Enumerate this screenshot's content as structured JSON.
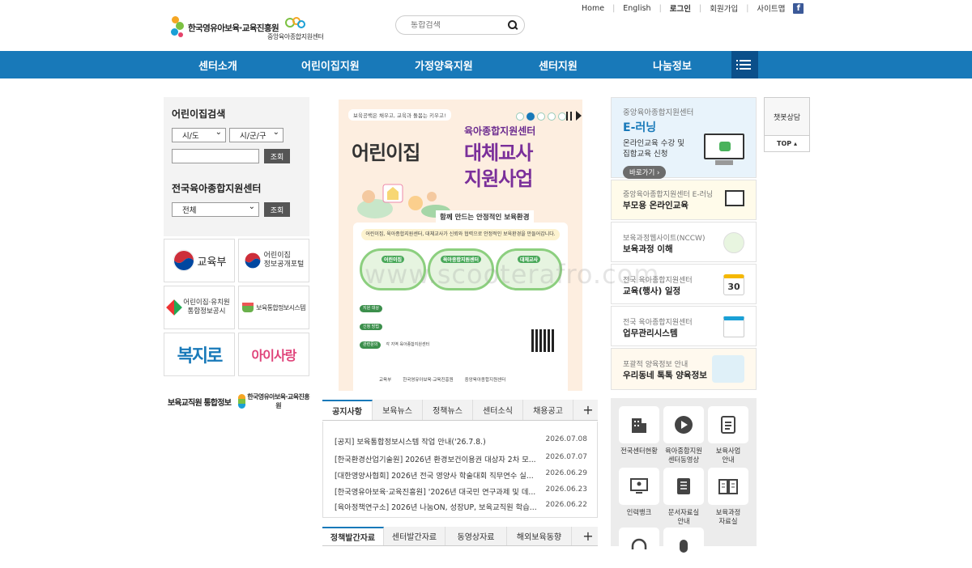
{
  "util": {
    "home": "Home",
    "english": "English",
    "login": "로그인",
    "join": "회원가입",
    "sitemap": "사이트맵",
    "facebook": "f"
  },
  "logo1": {
    "text": "한국영유아보육·교육진흥원"
  },
  "logo2": {
    "text": "중앙육아종합지원센터"
  },
  "search": {
    "placeholder": "통합검색"
  },
  "gnb": {
    "items": [
      "센터소개",
      "어린이집지원",
      "가정양육지원",
      "센터지원",
      "나눔정보"
    ]
  },
  "left": {
    "daycare_title": "어린이집검색",
    "sido": "시/도",
    "sigungu": "시/군/구",
    "search_btn": "조회",
    "center_title": "전국육아종합지원센터",
    "all": "전체",
    "search_btn2": "조회"
  },
  "banners": {
    "moe": "교육부",
    "portal": "어린이집\n정보공개포털",
    "integ": "어린이집·유치원\n통합정보공시",
    "childcare_sys": "보육통합정보시스템",
    "bokjiro": "복지로",
    "isarang": "아이사랑",
    "teacher": "보육교직원 통합정보",
    "kcpi": "한국영유아보육·교육진흥원"
  },
  "poster": {
    "topline": "보육공백은 채우고, 교육과 돌봄는 키우고!",
    "center": "육아종합지원센터",
    "w1": "어린이집",
    "w2": "대체교사",
    "w3": "지원사업",
    "subtitle": "함께 만드는 안정적인 보육환경",
    "desc": "어린이집, 육아종합지원센터, 대체교사가 신뢰와 협력으로 안정적인 보육환경을 만들어갑니다.",
    "c1": "어린이집",
    "c2": "육아종합지원센터",
    "c3": "대체교사",
    "info1": "지원 대상",
    "info2": "신청 방법",
    "info3": "관련문의",
    "info3_text": "각 지역 육아종합지원센터",
    "foot1": "교육부",
    "foot2": "한국영유아보육·교육진흥원",
    "foot3": "중앙육아종합지원센터"
  },
  "tabs1": {
    "items": [
      "공지사항",
      "보육뉴스",
      "정책뉴스",
      "센터소식",
      "채용공고"
    ],
    "plus": "+"
  },
  "notices": [
    {
      "title": "[공지] 보육통합정보시스템 작업 안내('26.7.8.)",
      "date": "2026.07.08"
    },
    {
      "title": "[한국환경산업기술원] 2026년 환경보건이용권 대상자 2차 모...",
      "date": "2026.07.07"
    },
    {
      "title": "[대한영양사협회] 2026년 전국 영양사 학술대회 직무연수 실...",
      "date": "2026.06.29"
    },
    {
      "title": "[한국영유아보육·교육진흥원] '2026년 대국민 연구과제 및 데...",
      "date": "2026.06.23"
    },
    {
      "title": "[육아정책연구소] 2026년 나눔ON, 성장UP, 보육교직원 학습...",
      "date": "2026.06.22"
    }
  ],
  "tabs2": {
    "items": [
      "정책발간자료",
      "센터발간자료",
      "동영상자료",
      "해외보육동향"
    ],
    "plus": "+"
  },
  "right": {
    "elearn_label": "중앙육아종합지원센터",
    "elearn_title": "E-러닝",
    "elearn_desc": "온라인교육 수강 및\n집합교육 신청",
    "elearn_go": "바로가기 ›",
    "b1_small": "중앙육아종합지원센터 E-러닝",
    "b1_big": "부모용 온라인교육",
    "b2_small": "보육과정웹사이트(NCCW)",
    "b2_big": "보육과정 이해",
    "b3_small": "전국 육아종합지원센터",
    "b3_big": "교육(행사) 일정",
    "b3_num": "30",
    "b4_small": "전국 육아종합지원센터",
    "b4_big": "업무관리시스템",
    "b5_small": "포괄적 양육정보 안내",
    "b5_big": "우리동네 톡톡 양육정보"
  },
  "chatbot": "챗봇상담",
  "top": "TOP ▴",
  "quick": [
    "전국센터현황",
    "육아종합지원\n센터동영상",
    "보육사업\n안내",
    "인력뱅크",
    "문서자료실\n안내",
    "보육과정\n자료실"
  ],
  "watermark": "www.scooterafro.com",
  "colors": {
    "primary": "#1879b9",
    "primary_dark": "#0b4f8a"
  }
}
